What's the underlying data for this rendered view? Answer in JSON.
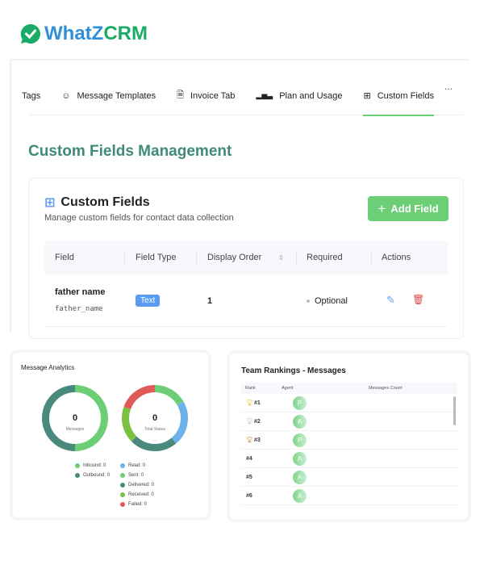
{
  "brand": {
    "part1": "WhatZ",
    "part2": "CRM"
  },
  "tabs": [
    {
      "label": "Tags",
      "icon": "tag-icon"
    },
    {
      "label": "Message Templates",
      "icon": "chat-icon"
    },
    {
      "label": "Invoice Tab",
      "icon": "document-icon"
    },
    {
      "label": "Plan and Usage",
      "icon": "bar-chart-icon"
    },
    {
      "label": "Custom Fields",
      "icon": "grid-icon",
      "active": true
    }
  ],
  "more_label": "...",
  "page_title": "Custom Fields Management",
  "card": {
    "title": "Custom Fields",
    "subtitle": "Manage custom fields for contact data collection",
    "add_button": "Add Field"
  },
  "table": {
    "columns": [
      "Field",
      "Field Type",
      "Display Order",
      "Required",
      "Actions"
    ],
    "rows": [
      {
        "name": "father name",
        "key": "father_name",
        "type": "Text",
        "order": "1",
        "required": "Optional"
      }
    ]
  },
  "analytics": {
    "title": "Message Analytics",
    "donut1": {
      "value": "0",
      "label": "Messages"
    },
    "donut2": {
      "value": "0",
      "label": "Total Status"
    },
    "legend1": [
      "Inbound: 0",
      "Outbound: 0"
    ],
    "legend2": [
      "Read: 0",
      "Sent: 0",
      "Delivered: 0",
      "Received: 0",
      "Failed: 0"
    ],
    "colors": {
      "inbound": "#6ccf76",
      "outbound": "#4a8a7c",
      "read": "#6db3ea",
      "sent": "#6ccf76",
      "delivered": "#4a8a7c",
      "received": "#79c043",
      "failed": "#e05a57"
    }
  },
  "rankings": {
    "title": "Team Rankings - Messages",
    "columns": [
      "Rank",
      "Agent",
      "Messages Count"
    ],
    "rows": [
      {
        "rank": "#1",
        "initial": "P",
        "trophy": "#f2c21b"
      },
      {
        "rank": "#2",
        "initial": "A",
        "trophy": "#c8c8c8"
      },
      {
        "rank": "#3",
        "initial": "P",
        "trophy": "#d08a3a"
      },
      {
        "rank": "#4",
        "initial": "A"
      },
      {
        "rank": "#5",
        "initial": "A"
      },
      {
        "rank": "#6",
        "initial": "A"
      }
    ]
  }
}
